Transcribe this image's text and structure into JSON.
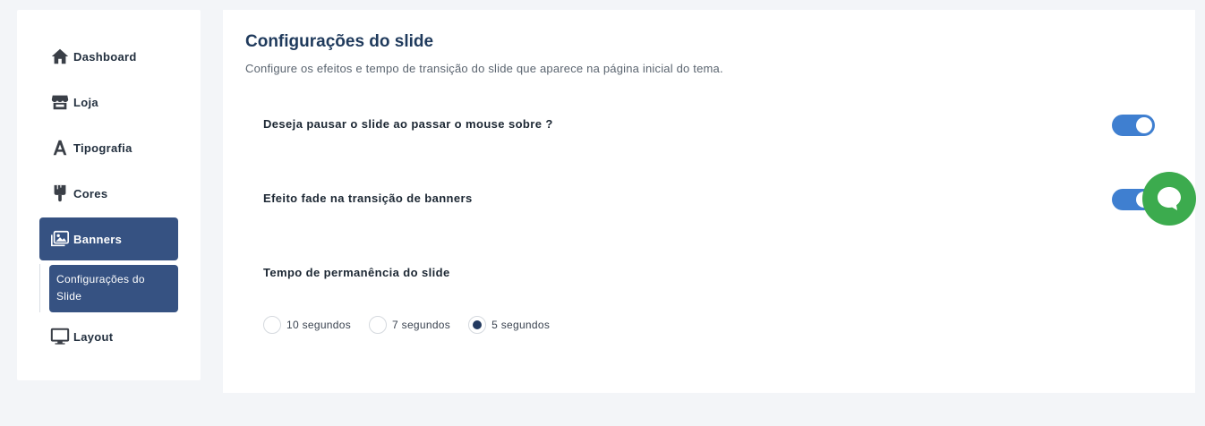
{
  "sidebar": {
    "items": [
      {
        "label": "Dashboard",
        "icon": "home-icon"
      },
      {
        "label": "Loja",
        "icon": "store-icon"
      },
      {
        "label": "Tipografia",
        "icon": "font-icon"
      },
      {
        "label": "Cores",
        "icon": "paint-brush-icon"
      },
      {
        "label": "Banners",
        "icon": "images-icon",
        "active": true
      },
      {
        "label": "Layout",
        "icon": "monitor-icon"
      }
    ],
    "sub_item": "Configurações do Slide"
  },
  "panel": {
    "title": "Configurações do slide",
    "subtitle": "Configure os efeitos e tempo de transição do slide que aparece na página inicial do tema.",
    "options": [
      {
        "label": "Deseja pausar o slide ao passar o mouse sobre ?",
        "enabled": true
      },
      {
        "label": "Efeito fade na transição de banners",
        "enabled": true
      }
    ],
    "duration_label": "Tempo de permanência do slide",
    "radios": [
      {
        "label": "10 segundos",
        "checked": false
      },
      {
        "label": "7 segundos",
        "checked": false
      },
      {
        "label": "5 segundos",
        "checked": true
      }
    ]
  },
  "colors": {
    "accent": "#365282",
    "toggle": "#3f7fd0",
    "chat": "#3cab4e"
  }
}
